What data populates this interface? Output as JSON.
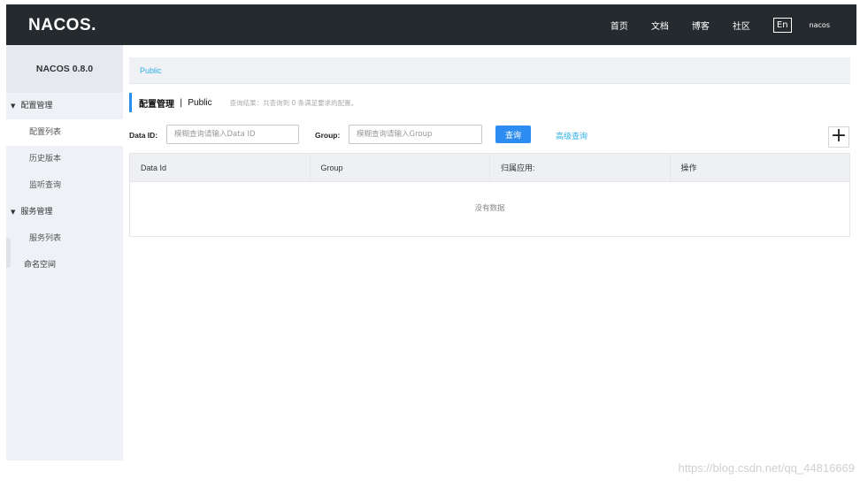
{
  "header": {
    "logo": "NACOS.",
    "nav": [
      "首页",
      "文档",
      "博客",
      "社区"
    ],
    "lang": "En",
    "user": "nacos"
  },
  "sidebar": {
    "version": "NACOS 0.8.0",
    "config_group": "配置管理",
    "config_items": [
      "配置列表",
      "历史版本",
      "监听查询"
    ],
    "service_group": "服务管理",
    "service_items": [
      "服务列表"
    ],
    "namespace": "命名空间"
  },
  "main": {
    "breadcrumb": "Public",
    "title": "配置管理",
    "separator": "|",
    "namespace": "Public",
    "result_text": "查询结果：共查询到 0 条满足要求的配置。",
    "filter": {
      "data_id_label": "Data ID:",
      "data_id_placeholder": "模糊查询请输入Data ID",
      "group_label": "Group:",
      "group_placeholder": "模糊查询请输入Group",
      "search_label": "查询",
      "advanced_label": "高级查询",
      "add_label": "+"
    },
    "table": {
      "columns": [
        "Data Id",
        "Group",
        "归属应用:",
        "操作"
      ],
      "empty_text": "没有数据"
    }
  },
  "watermark": "https://blog.csdn.net/qq_44816669",
  "colors": {
    "topbar": "#252a2f",
    "sidebar": "#eef1f6",
    "primary": "#2d8cf0",
    "link": "#2fb0e5"
  }
}
